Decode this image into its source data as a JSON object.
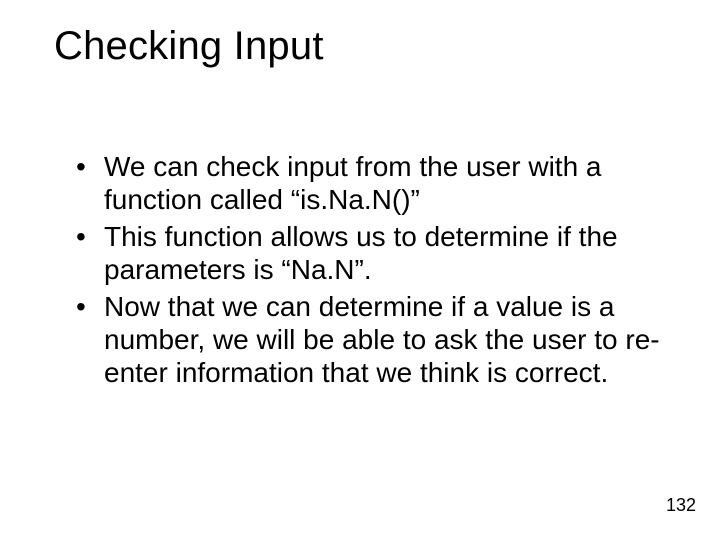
{
  "slide": {
    "title": "Checking Input",
    "bullets": [
      "We can check input from the user with a function called “is.Na.N()”",
      "This function allows us to determine if the parameters is “Na.N”.",
      "Now that we can determine if a value is a number, we will be able to ask the user to re-enter information that we think is correct."
    ],
    "page_number": "132"
  }
}
